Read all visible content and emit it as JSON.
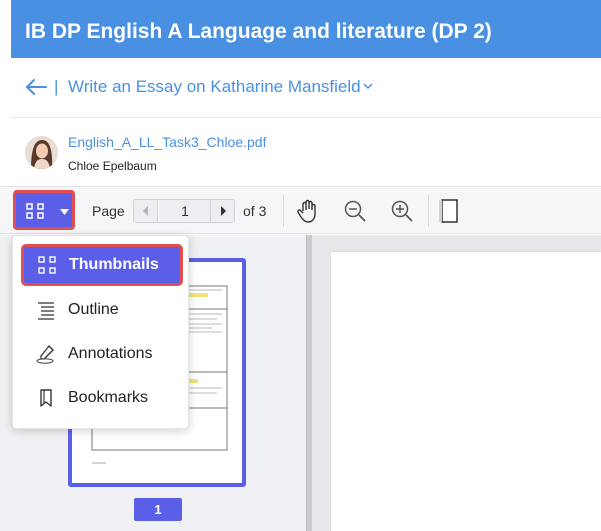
{
  "header": {
    "title": "IB DP English A Language and literature (DP 2)"
  },
  "assignment": {
    "separator": "|",
    "title": "Write an Essay on Katharine Mansfield"
  },
  "file": {
    "name": "English_A_LL_Task3_Chloe.pdf",
    "owner": "Chloe Epelbaum"
  },
  "toolbar": {
    "page_label": "Page",
    "current_page": "1",
    "total_label": "of 3"
  },
  "menu": {
    "items": [
      {
        "label": "Thumbnails",
        "icon": "thumbnails-icon",
        "active": true
      },
      {
        "label": "Outline",
        "icon": "outline-icon",
        "active": false
      },
      {
        "label": "Annotations",
        "icon": "annotations-icon",
        "active": false
      },
      {
        "label": "Bookmarks",
        "icon": "bookmark-icon",
        "active": false
      }
    ]
  },
  "thumbnail": {
    "page_number": "1"
  },
  "colors": {
    "header": "#4a90e2",
    "accent": "#5b5fe8",
    "highlight_border": "#e04f4f",
    "link": "#4a90e2"
  }
}
